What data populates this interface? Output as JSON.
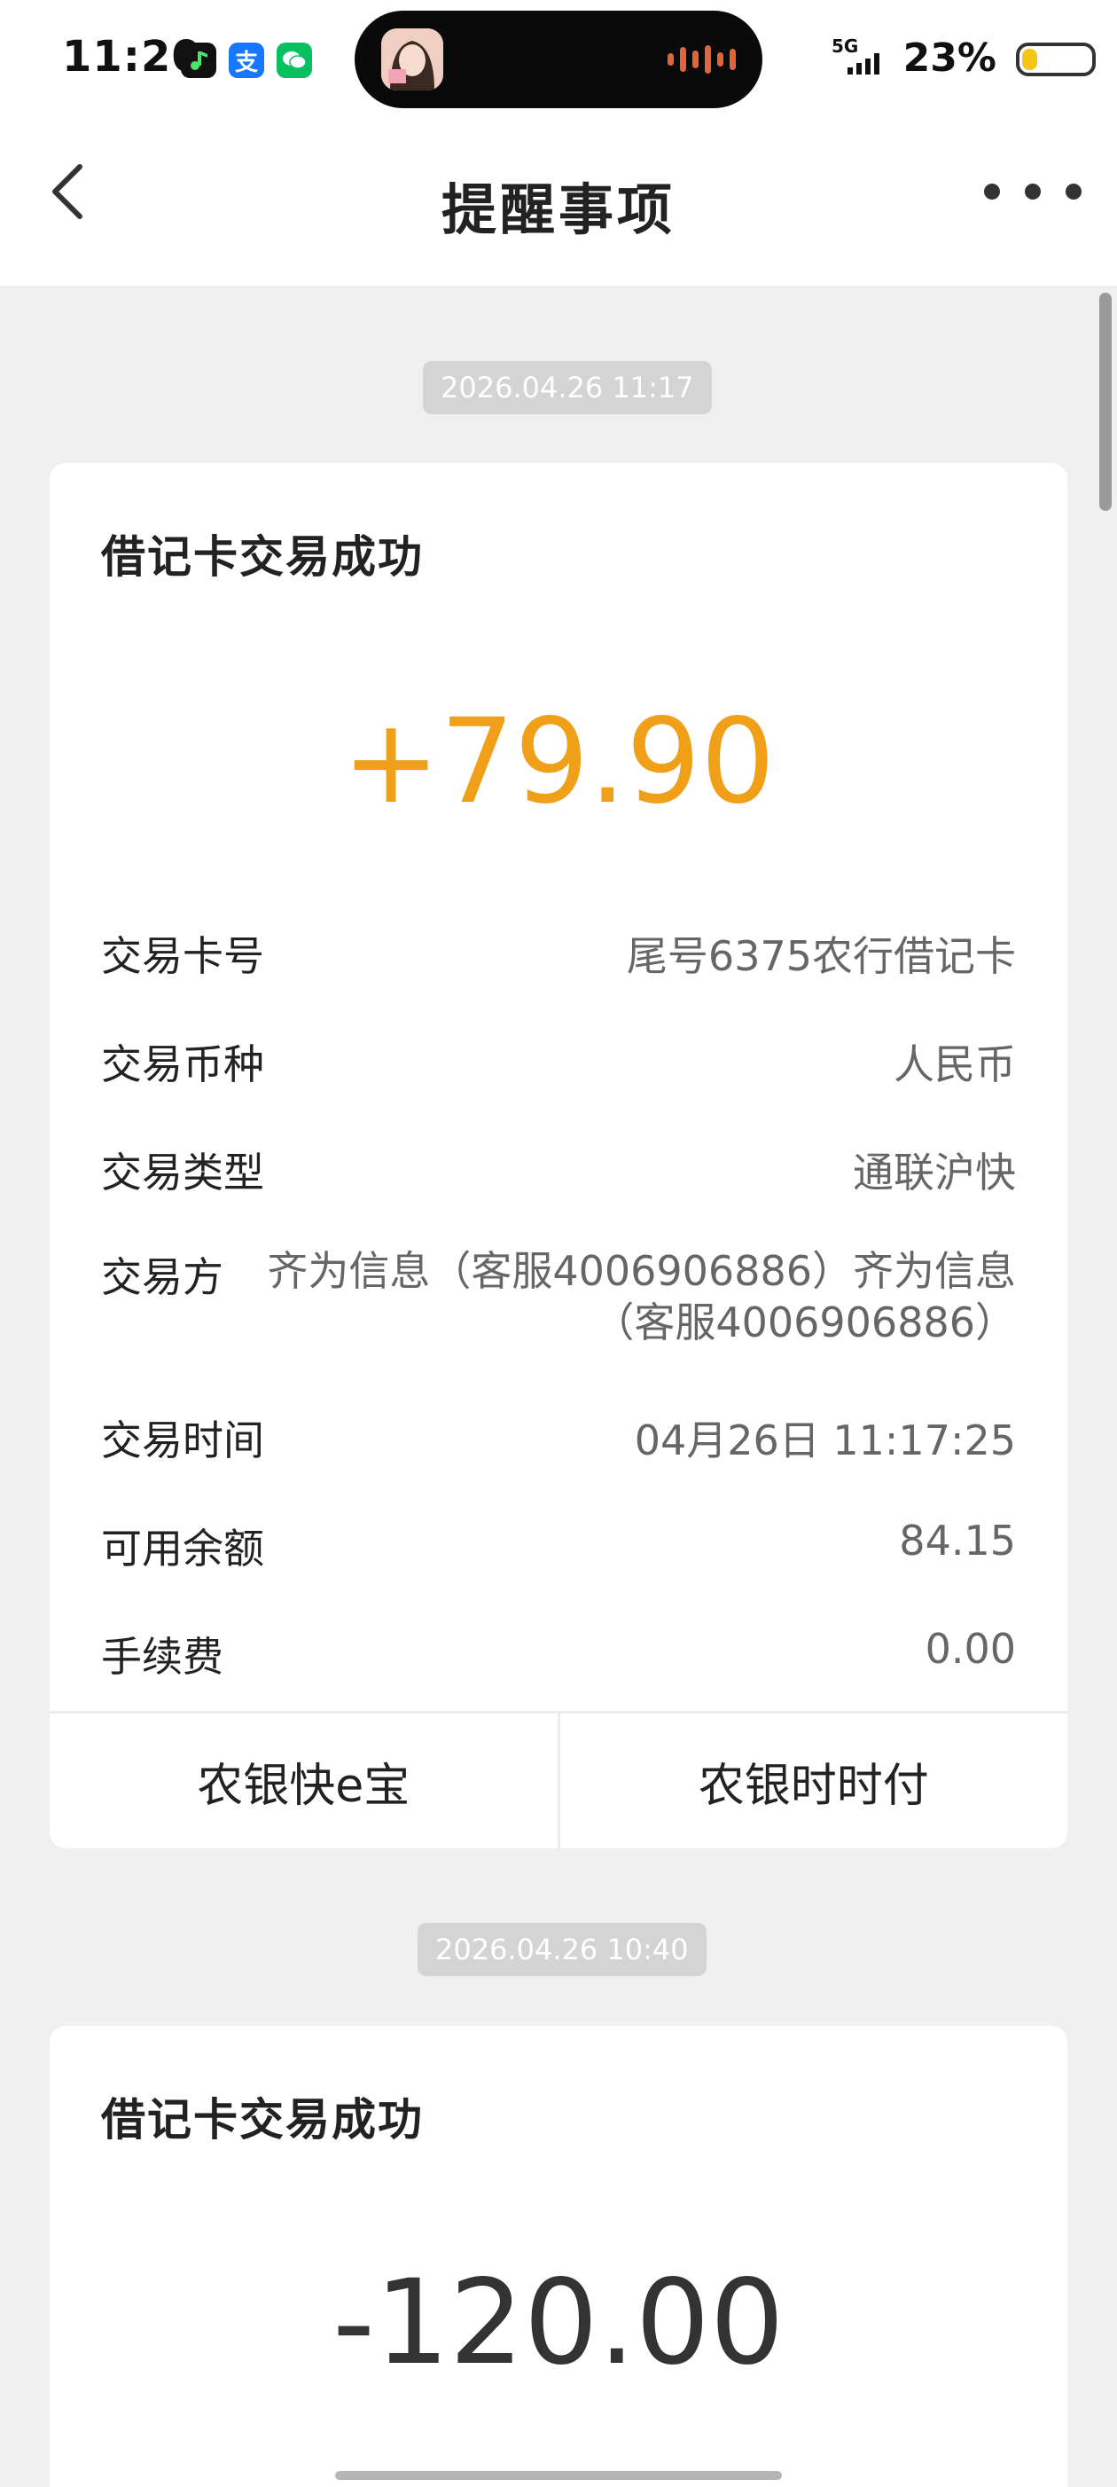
{
  "status_bar": {
    "time": "11:20",
    "network": "5G",
    "battery_percent": "23%",
    "battery_level": 0.23,
    "notification_icons": [
      "music-app-icon",
      "alipay-icon",
      "wechat-icon"
    ],
    "alipay_glyph": "支"
  },
  "nav": {
    "title": "提醒事项",
    "back_icon": "chevron-left-icon",
    "more_icon": "more-dots-icon"
  },
  "messages": [
    {
      "timestamp": "2026.04.26 11:17",
      "title": "借记卡交易成功",
      "amount": "+79.90",
      "details": [
        {
          "label": "交易卡号",
          "value": "尾号6375农行借记卡"
        },
        {
          "label": "交易币种",
          "value": "人民币"
        },
        {
          "label": "交易类型",
          "value": "通联沪快"
        },
        {
          "label": "交易方",
          "value": "齐为信息（客服4006906886）齐为信息（客服4006906886）"
        },
        {
          "label": "交易时间",
          "value": "04月26日 11:17:25"
        },
        {
          "label": "可用余额",
          "value": "84.15"
        },
        {
          "label": "手续费",
          "value": "0.00"
        }
      ],
      "actions": [
        "农银快e宝",
        "农银时时付"
      ]
    },
    {
      "timestamp": "2026.04.26 10:40",
      "title": "借记卡交易成功",
      "amount": "-120.00"
    }
  ],
  "colors": {
    "income_amount": "#f0a018",
    "expense_amount": "#333333",
    "timestamp_bg": "#d4d4d4",
    "page_bg": "#f0f0f0"
  }
}
